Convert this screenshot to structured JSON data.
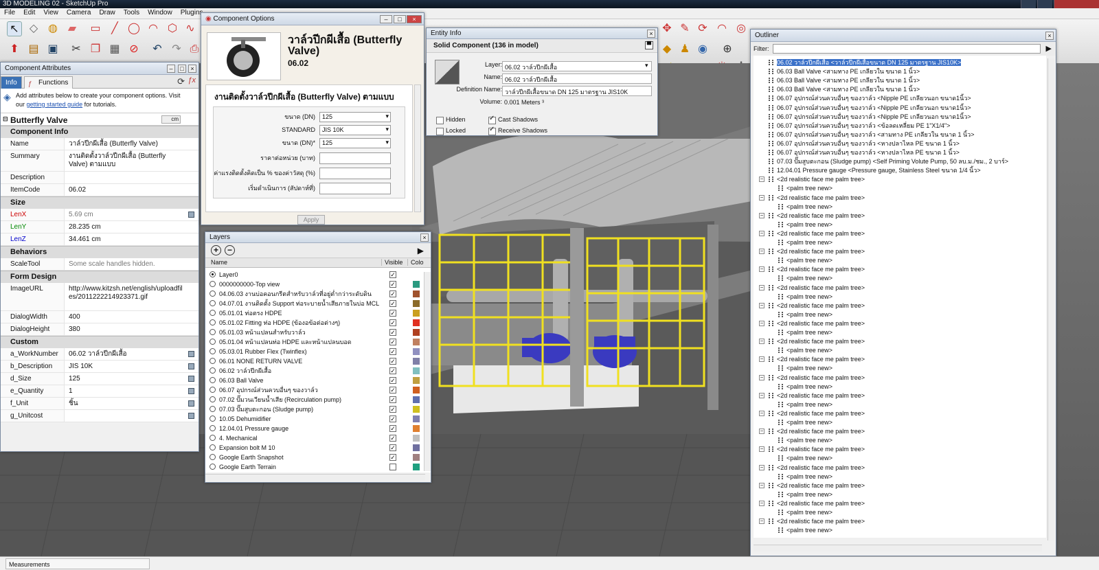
{
  "app": {
    "title": "3D MODELING 02 - SketchUp Pro",
    "menu": [
      "File",
      "Edit",
      "View",
      "Camera",
      "Draw",
      "Tools",
      "Window",
      "Plugins"
    ]
  },
  "status": {
    "measurements": "Measurements"
  },
  "component_attributes": {
    "title": "Component Attributes",
    "tabs": [
      "Info",
      "Functions"
    ],
    "help_prefix": "Add attributes below to create your component options. Visit",
    "help_mid": "our",
    "help_link": "getting started guide",
    "help_suffix": "for tutorials.",
    "component": "Butterfly Valve",
    "unit_badge": "cm",
    "sections": {
      "info": "Component Info",
      "size": "Size",
      "behaviors": "Behaviors",
      "form": "Form Design",
      "custom": "Custom"
    },
    "info_rows": [
      {
        "k": "Name",
        "v": "วาล์วปีกผีเสื้อ (Butterfly Valve)"
      },
      {
        "k": "Summary",
        "v": "งานติดตั้งวาล์วปีกผีเสื้อ (Butterfly Valve) ตามแบบ"
      },
      {
        "k": "Description",
        "v": ""
      },
      {
        "k": "ItemCode",
        "v": "06.02"
      }
    ],
    "size_rows": [
      {
        "k": "LenX",
        "v": "5.69 cm"
      },
      {
        "k": "LenY",
        "v": "28.235 cm"
      },
      {
        "k": "LenZ",
        "v": "34.461 cm"
      }
    ],
    "behavior_rows": [
      {
        "k": "ScaleTool",
        "v": "Some scale handles hidden."
      }
    ],
    "form_rows": [
      {
        "k": "ImageURL",
        "v": "http://www.kitzsh.net/english/uploadfiles/2011222214923371.gif"
      },
      {
        "k": "DialogWidth",
        "v": "400"
      },
      {
        "k": "DialogHeight",
        "v": "380"
      }
    ],
    "custom_rows": [
      {
        "k": "a_WorkNumber",
        "v": "06.02 วาล์วปีกผีเสื้อ"
      },
      {
        "k": "b_Description",
        "v": "JIS 10K"
      },
      {
        "k": "d_Size",
        "v": "125"
      },
      {
        "k": "e_Quantity",
        "v": "1"
      },
      {
        "k": "f_Unit",
        "v": "ชิ้น"
      },
      {
        "k": "g_Unitcost",
        "v": ""
      }
    ]
  },
  "component_options": {
    "title": "Component Options",
    "heading": "วาล์วปีกผีเสื้อ (Butterfly Valve)",
    "code": "06.02",
    "description": "งานติดตั้งวาล์วปีกผีเสื้อ (Butterfly Valve) ตามแบบ",
    "fields": [
      {
        "label": "ขนาด (DN)",
        "value": "125",
        "select": true
      },
      {
        "label": "STANDARD",
        "value": "JIS 10K",
        "select": true
      },
      {
        "label": "ขนาด (DN)*",
        "value": "125",
        "select": true
      },
      {
        "label": "ราคาต่อหน่วย (บาท)",
        "value": "",
        "select": false
      },
      {
        "label": "ค่าแรงติดตั้งคิดเป็น % ของค่าวัสดุ (%)",
        "value": "",
        "select": false
      },
      {
        "label": "เริ่มดำเนินการ (สัปดาห์ที่)",
        "value": "",
        "select": false
      }
    ],
    "apply": "Apply"
  },
  "entity_info": {
    "title": "Entity Info",
    "summary": "Solid Component (136 in model)",
    "layer_label": "Layer:",
    "layer": "06.02 วาล์วปีกผีเสื้อ",
    "name_label": "Name:",
    "name": "06.02 วาล์วปีกผีเสื้อ",
    "def_label": "Definition Name:",
    "definition": "วาล์วปีกผีเสื้อขนาด DN 125 มาตรฐาน JIS10K",
    "vol_label": "Volume:",
    "volume": "0.001 Meters ³",
    "hidden": "Hidden",
    "locked": "Locked",
    "cast": "Cast Shadows",
    "receive": "Receive Shadows"
  },
  "layers": {
    "title": "Layers",
    "col_name": "Name",
    "col_visible": "Visible",
    "col_color": "Colo",
    "rows": [
      {
        "name": "Layer0",
        "active": true,
        "visible": true,
        "color": ""
      },
      {
        "name": "0000000000-Top view",
        "active": false,
        "visible": true,
        "color": "#2a9a80"
      },
      {
        "name": "04.06.03 งานบ่อคอนกรีตสำหรับวาล์วที่อยู่ต่ำกว่าระดับดิน",
        "active": false,
        "visible": true,
        "color": "#a0522d"
      },
      {
        "name": "04.07.01 งานติดตั้ง Support ท่อระบายน้ำเสียภายในบ่อ MCL",
        "active": false,
        "visible": true,
        "color": "#8b6b2a"
      },
      {
        "name": "05.01.01 ท่อตรง HDPE",
        "active": false,
        "visible": true,
        "color": "#caa020"
      },
      {
        "name": "05.01.02 Fitting ท่อ HDPE (ข้องอข้อต่อต่างๆ)",
        "active": false,
        "visible": true,
        "color": "#e03020"
      },
      {
        "name": "05.01.03 หน้าแปลนสำหรับวาล์ว",
        "active": false,
        "visible": true,
        "color": "#b04020"
      },
      {
        "name": "05.01.04 หน้าแปลนท่อ HDPE และหน้าแปลนบอด",
        "active": false,
        "visible": true,
        "color": "#c08060"
      },
      {
        "name": "05.03.01 Rubber Flex (Twinflex)",
        "active": false,
        "visible": true,
        "color": "#9090c0"
      },
      {
        "name": "06.01 NONE RETURN VALVE",
        "active": false,
        "visible": true,
        "color": "#8080a8"
      },
      {
        "name": "06.02 วาล์วปีกผีเสื้อ",
        "active": false,
        "visible": true,
        "color": "#80c0c0"
      },
      {
        "name": "06.03 Ball Valve",
        "active": false,
        "visible": true,
        "color": "#c0a040"
      },
      {
        "name": "06.07 อุปกรณ์ส่วนควบอื่นๆ ของวาล์ว",
        "active": false,
        "visible": true,
        "color": "#d06020"
      },
      {
        "name": "07.02 ปั๊มวนเวียนน้ำเสีย (Recirculation pump)",
        "active": false,
        "visible": true,
        "color": "#6070b0"
      },
      {
        "name": "07.03 ปั๊มสูบตะกอน (Sludge pump)",
        "active": false,
        "visible": true,
        "color": "#d0c020"
      },
      {
        "name": "10.05 Dehumidifier",
        "active": false,
        "visible": true,
        "color": "#8080b0"
      },
      {
        "name": "12.04.01 Pressure gauge",
        "active": false,
        "visible": true,
        "color": "#e08030"
      },
      {
        "name": "4. Mechanical",
        "active": false,
        "visible": true,
        "color": "#c0c0c0"
      },
      {
        "name": "Expansion bolt M 10",
        "active": false,
        "visible": true,
        "color": "#7070a0"
      },
      {
        "name": "Google Earth Snapshot",
        "active": false,
        "visible": true,
        "color": "#a08080"
      },
      {
        "name": "Google Earth Terrain",
        "active": false,
        "visible": false,
        "color": "#20a080"
      }
    ]
  },
  "outliner": {
    "title": "Outliner",
    "filter_label": "Filter:",
    "rows": [
      {
        "text": "06.02 วาล์วปีกผีเสื้อ <วาล์วปีกผีเสื้อขนาด DN 125 มาตรฐาน JIS10K>",
        "level": 1,
        "highlight": true,
        "expander": ""
      },
      {
        "text": "06.03 Ball Valve <สามทาง PE เกลียวใน ขนาด 1 นิ้ว>",
        "level": 1,
        "highlight": false,
        "expander": ""
      },
      {
        "text": "06.03 Ball Valve <สามทาง PE เกลียวใน ขนาด 1 นิ้ว>",
        "level": 1,
        "highlight": false,
        "expander": ""
      },
      {
        "text": "06.03 Ball Valve <สามทาง PE เกลียวใน ขนาด 1 นิ้ว>",
        "level": 1,
        "highlight": false,
        "expander": ""
      },
      {
        "text": "06.07 อุปกรณ์ส่วนควบอื่นๆ ของวาล์ว <Nipple PE เกลียวนอก ขนาด1นิ้ว>",
        "level": 1,
        "highlight": false,
        "expander": ""
      },
      {
        "text": "06.07 อุปกรณ์ส่วนควบอื่นๆ ของวาล์ว <Nipple PE เกลียวนอก ขนาด1นิ้ว>",
        "level": 1,
        "highlight": false,
        "expander": ""
      },
      {
        "text": "06.07 อุปกรณ์ส่วนควบอื่นๆ ของวาล์ว <Nipple PE เกลียวนอก ขนาด1นิ้ว>",
        "level": 1,
        "highlight": false,
        "expander": ""
      },
      {
        "text": "06.07 อุปกรณ์ส่วนควบอื่นๆ ของวาล์ว <ข้อลดเหลี่ยม PE 1\"X1/4\">",
        "level": 1,
        "highlight": false,
        "expander": ""
      },
      {
        "text": "06.07 อุปกรณ์ส่วนควบอื่นๆ ของวาล์ว <สามทาง PE เกลียวใน ขนาด 1 นิ้ว>",
        "level": 1,
        "highlight": false,
        "expander": ""
      },
      {
        "text": "06.07 อุปกรณ์ส่วนควบอื่นๆ ของวาล์ว <หางปลาไหล PE ขนาด 1 นิ้ว>",
        "level": 1,
        "highlight": false,
        "expander": ""
      },
      {
        "text": "06.07 อุปกรณ์ส่วนควบอื่นๆ ของวาล์ว <หางปลาไหล PE ขนาด 1 นิ้ว>",
        "level": 1,
        "highlight": false,
        "expander": ""
      },
      {
        "text": "07.03 ปั๊มสูบตะกอน (Sludge pump) <Self Priming Volute Pump, 50 ลบ.ม./ชม., 2 บาร์>",
        "level": 1,
        "highlight": false,
        "expander": ""
      },
      {
        "text": "12.04.01 Pressure gauge <Pressure gauge, Stainless Steel ขนาด 1/4 นิ้ว>",
        "level": 1,
        "highlight": false,
        "expander": ""
      },
      {
        "text": "<2d realistic face me palm tree>",
        "level": 1,
        "highlight": false,
        "expander": "−"
      },
      {
        "text": "<palm tree new>",
        "level": 2,
        "highlight": false,
        "expander": ""
      },
      {
        "text": "<2d realistic face me palm tree>",
        "level": 1,
        "highlight": false,
        "expander": "−"
      },
      {
        "text": "<palm tree new>",
        "level": 2,
        "highlight": false,
        "expander": ""
      },
      {
        "text": "<2d realistic face me palm tree>",
        "level": 1,
        "highlight": false,
        "expander": "−"
      },
      {
        "text": "<palm tree new>",
        "level": 2,
        "highlight": false,
        "expander": ""
      },
      {
        "text": "<2d realistic face me palm tree>",
        "level": 1,
        "highlight": false,
        "expander": "−"
      },
      {
        "text": "<palm tree new>",
        "level": 2,
        "highlight": false,
        "expander": ""
      },
      {
        "text": "<2d realistic face me palm tree>",
        "level": 1,
        "highlight": false,
        "expander": "−"
      },
      {
        "text": "<palm tree new>",
        "level": 2,
        "highlight": false,
        "expander": ""
      },
      {
        "text": "<2d realistic face me palm tree>",
        "level": 1,
        "highlight": false,
        "expander": "−"
      },
      {
        "text": "<palm tree new>",
        "level": 2,
        "highlight": false,
        "expander": ""
      },
      {
        "text": "<2d realistic face me palm tree>",
        "level": 1,
        "highlight": false,
        "expander": "−"
      },
      {
        "text": "<palm tree new>",
        "level": 2,
        "highlight": false,
        "expander": ""
      },
      {
        "text": "<2d realistic face me palm tree>",
        "level": 1,
        "highlight": false,
        "expander": "−"
      },
      {
        "text": "<palm tree new>",
        "level": 2,
        "highlight": false,
        "expander": ""
      },
      {
        "text": "<2d realistic face me palm tree>",
        "level": 1,
        "highlight": false,
        "expander": "−"
      },
      {
        "text": "<palm tree new>",
        "level": 2,
        "highlight": false,
        "expander": ""
      },
      {
        "text": "<2d realistic face me palm tree>",
        "level": 1,
        "highlight": false,
        "expander": "−"
      },
      {
        "text": "<palm tree new>",
        "level": 2,
        "highlight": false,
        "expander": ""
      },
      {
        "text": "<2d realistic face me palm tree>",
        "level": 1,
        "highlight": false,
        "expander": "−"
      },
      {
        "text": "<palm tree new>",
        "level": 2,
        "highlight": false,
        "expander": ""
      },
      {
        "text": "<2d realistic face me palm tree>",
        "level": 1,
        "highlight": false,
        "expander": "−"
      },
      {
        "text": "<palm tree new>",
        "level": 2,
        "highlight": false,
        "expander": ""
      },
      {
        "text": "<2d realistic face me palm tree>",
        "level": 1,
        "highlight": false,
        "expander": "−"
      },
      {
        "text": "<palm tree new>",
        "level": 2,
        "highlight": false,
        "expander": ""
      },
      {
        "text": "<2d realistic face me palm tree>",
        "level": 1,
        "highlight": false,
        "expander": "−"
      },
      {
        "text": "<palm tree new>",
        "level": 2,
        "highlight": false,
        "expander": ""
      },
      {
        "text": "<2d realistic face me palm tree>",
        "level": 1,
        "highlight": false,
        "expander": "−"
      },
      {
        "text": "<palm tree new>",
        "level": 2,
        "highlight": false,
        "expander": ""
      },
      {
        "text": "<2d realistic face me palm tree>",
        "level": 1,
        "highlight": false,
        "expander": "−"
      },
      {
        "text": "<palm tree new>",
        "level": 2,
        "highlight": false,
        "expander": ""
      },
      {
        "text": "<2d realistic face me palm tree>",
        "level": 1,
        "highlight": false,
        "expander": "−"
      },
      {
        "text": "<palm tree new>",
        "level": 2,
        "highlight": false,
        "expander": ""
      },
      {
        "text": "<2d realistic face me palm tree>",
        "level": 1,
        "highlight": false,
        "expander": "−"
      },
      {
        "text": "<palm tree new>",
        "level": 2,
        "highlight": false,
        "expander": ""
      },
      {
        "text": "<2d realistic face me palm tree>",
        "level": 1,
        "highlight": false,
        "expander": "−"
      },
      {
        "text": "<palm tree new>",
        "level": 2,
        "highlight": false,
        "expander": ""
      },
      {
        "text": "<2d realistic face me palm tree>",
        "level": 1,
        "highlight": false,
        "expander": "−"
      },
      {
        "text": "<palm tree new>",
        "level": 2,
        "highlight": false,
        "expander": ""
      }
    ]
  },
  "colors": {
    "highlight": "#3a70c8",
    "railing": "#f0e020",
    "pump": "#3a3ac0",
    "roof": "#b8b8b8"
  },
  "icons": [
    "select-icon",
    "eraser-icon",
    "paint-bucket-icon",
    "line-icon",
    "arc-icon",
    "orbit-icon",
    "pan-icon",
    "zoom-icon",
    "undo-icon",
    "redo-icon",
    "add-layer-icon",
    "remove-layer-icon",
    "details-icon",
    "refresh-icon",
    "close-icon"
  ]
}
